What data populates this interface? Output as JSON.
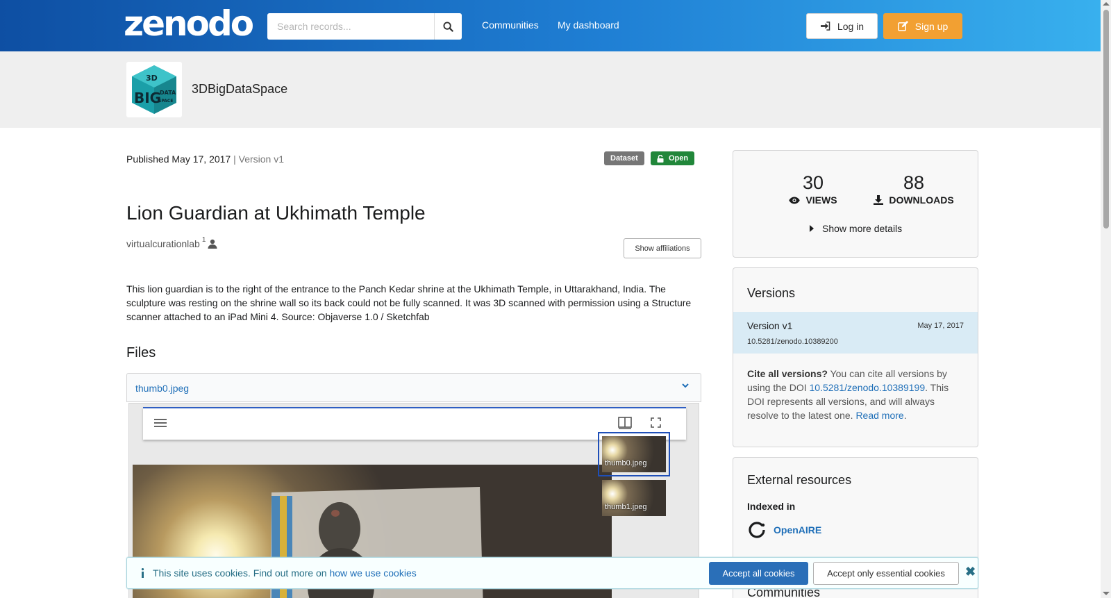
{
  "header": {
    "logo_text": "zenodo",
    "search_placeholder": "Search records...",
    "nav": [
      "Communities",
      "My dashboard"
    ],
    "login_label": "Log in",
    "signup_label": "Sign up"
  },
  "community": {
    "name": "3DBigDataSpace",
    "logo_text": [
      "3D",
      "BIG",
      "DATA",
      "SPACE"
    ]
  },
  "record": {
    "published": "Published May 17, 2017",
    "version_suffix": "| Version v1",
    "resource_type": "Dataset",
    "access": "Open",
    "title": "Lion Guardian at Ukhimath Temple",
    "creator": "virtualcurationlab",
    "creator_affiliation_index": "1",
    "show_affiliations_label": "Show affiliations",
    "description": "This lion guardian is to the right of the entrance to the Panch Kedar shrine at the Ukhimath Temple, in Uttarakhand, India. The sculpture was resting on the shrine wall so its back could not be fully scanned. It was 3D scanned with permission using a Structure scanner attached to an iPad Mini 4. Source: Objaverse 1.0 / Sketchfab",
    "files_heading": "Files",
    "file_name": "thumb0.jpeg",
    "thumbnails": [
      "thumb0.jpeg",
      "thumb1.jpeg"
    ]
  },
  "stats": {
    "views": "30",
    "views_label": "VIEWS",
    "downloads": "88",
    "downloads_label": "DOWNLOADS",
    "more_details_label": "Show more details"
  },
  "versions": {
    "title": "Versions",
    "current": {
      "name": "Version v1",
      "date": "May 17, 2017",
      "doi": "10.5281/zenodo.10389200"
    },
    "cite_bold": "Cite all versions?",
    "cite_text_1": " You can cite all versions by using the DOI ",
    "cite_doi": "10.5281/zenodo.10389199",
    "cite_text_2": ". This DOI represents all versions, and will always resolve to the latest one. ",
    "read_more": "Read more",
    "cite_end": "."
  },
  "external": {
    "title": "External resources",
    "indexed_in": "Indexed in",
    "openaire": "OpenAIRE",
    "communities_title": "Communities"
  },
  "cookies": {
    "text": "This site uses cookies. Find out more on ",
    "link": "how we use cookies",
    "accept_all": "Accept all cookies",
    "accept_essential": "Accept only essential cookies"
  },
  "colors": {
    "header_start": "#0e4fa3",
    "header_end": "#38b0ee",
    "signup": "#f2a032",
    "open_label": "#21873a",
    "link": "#1f6fb8",
    "version_highlight": "#d9ebf5"
  }
}
